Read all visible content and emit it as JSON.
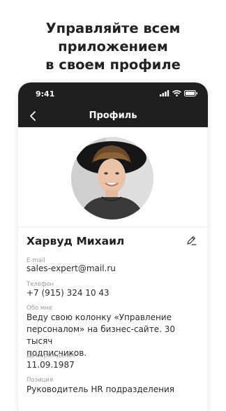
{
  "headline": {
    "line1": "Управляйте всем",
    "line2": "приложением",
    "line3": "в своем профиле"
  },
  "status_bar": {
    "time": "9:41"
  },
  "nav": {
    "title": "Профиль",
    "back_icon": "chevron-left-icon"
  },
  "profile": {
    "name": "Харвуд Михаил",
    "fields": [
      {
        "label": "E-mail",
        "value": "sales-expert@mail.ru"
      },
      {
        "label": "Телефон",
        "value": "+7 (915) 324 10 43"
      },
      {
        "label": "Обо мне",
        "value_lines": [
          "Веду свою колонку «Управление",
          "персоналом» на бизнес-сайте. 30 тысяч",
          "подписчиков."
        ]
      },
      {
        "label": "Дата рождения",
        "value": "11.09.1987"
      },
      {
        "label": "Позиция",
        "value": "Руководитель HR подразделения"
      }
    ]
  },
  "colors": {
    "header_bg": "#1f1f1f",
    "text": "#1f1f1f",
    "label": "#9a9a9a"
  }
}
